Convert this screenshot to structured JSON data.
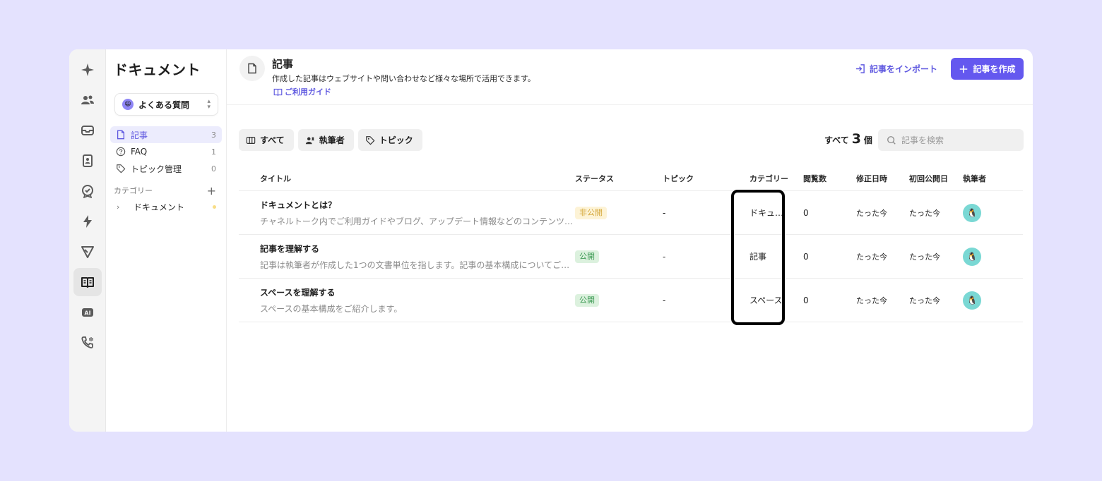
{
  "rail": {
    "items": [
      {
        "icon": "sparkle-icon",
        "active": false
      },
      {
        "icon": "users-icon",
        "active": false
      },
      {
        "icon": "inbox-icon",
        "active": false
      },
      {
        "icon": "contact-card-icon",
        "active": false
      },
      {
        "icon": "badge-check-icon",
        "active": false
      },
      {
        "icon": "lightning-icon",
        "active": false
      },
      {
        "icon": "send-icon",
        "active": false
      },
      {
        "icon": "book-open-icon",
        "active": true
      },
      {
        "icon": "ai-icon",
        "active": false
      },
      {
        "icon": "phone-icon",
        "active": false
      }
    ]
  },
  "sidebar": {
    "title": "ドキュメント",
    "workspace": {
      "emoji": "😀",
      "name": "よくある質問"
    },
    "nav": [
      {
        "label": "記事",
        "count": "3",
        "icon": "document-icon",
        "active": true
      },
      {
        "label": "FAQ",
        "count": "1",
        "icon": "question-circle-icon",
        "active": false
      },
      {
        "label": "トピック管理",
        "count": "0",
        "icon": "tag-icon",
        "active": false
      }
    ],
    "category_header": "カテゴリー",
    "category_add": "+",
    "categories": [
      {
        "label": "ドキュメント",
        "chevron": "›"
      }
    ]
  },
  "header": {
    "title": "記事",
    "description": "作成した記事はウェブサイトや問い合わせなど様々な場所で活用できます。",
    "guide_link": "ご利用ガイド",
    "import_label": "記事をインポート",
    "create_label": "記事を作成"
  },
  "toolbar": {
    "filters": [
      {
        "label": "すべて",
        "icon": "columns-icon"
      },
      {
        "label": "執筆者",
        "icon": "author-icon"
      },
      {
        "label": "トピック",
        "icon": "tag-icon"
      }
    ],
    "count_prefix": "すべて",
    "count_value": "3",
    "count_suffix": "個",
    "search_placeholder": "記事を検索"
  },
  "table": {
    "columns": [
      "タイトル",
      "ステータス",
      "トピック",
      "カテゴリー",
      "閲覧数",
      "修正日時",
      "初回公開日",
      "執筆者"
    ],
    "rows": [
      {
        "title": "ドキュメントとは？",
        "desc": "チャネルトーク内でご利用ガイドやブログ、アップデート情報などのコンテンツ…",
        "status": "非公開",
        "status_type": "unpub",
        "topic": "-",
        "category": "ドキュ…",
        "views": "0",
        "modified": "たった今",
        "published": "たった今",
        "author_emoji": "🐧"
      },
      {
        "title": "記事を理解する",
        "desc": "記事は執筆者が作成した1つの文書単位を指します。記事の基本構成についてご紹…",
        "status": "公開",
        "status_type": "pub",
        "topic": "-",
        "category": "記事",
        "views": "0",
        "modified": "たった今",
        "published": "たった今",
        "author_emoji": "🐧"
      },
      {
        "title": "スペースを理解する",
        "desc": "スペースの基本構成をご紹介します。",
        "status": "公開",
        "status_type": "pub",
        "topic": "-",
        "category": "スペース",
        "views": "0",
        "modified": "たった今",
        "published": "たった今",
        "author_emoji": "🐧"
      }
    ]
  },
  "colors": {
    "accent": "#6458ef",
    "background": "#e4e2fe",
    "unpublished": "#d5a83c",
    "published": "#3c9a53"
  }
}
